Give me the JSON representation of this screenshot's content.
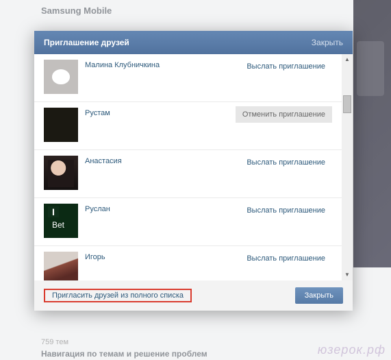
{
  "background": {
    "group_title": "Samsung Mobile",
    "topics_count": "759 тем",
    "nav_heading": "Навигация по темам и решение проблем",
    "watermark": "юзерок.рф"
  },
  "modal": {
    "title": "Приглашение друзей",
    "close_top": "Закрыть",
    "friends": [
      {
        "name": "Малина Клубничкина",
        "action": "Выслать приглашение",
        "cancelled": false,
        "avatar": "av-deer"
      },
      {
        "name": "Рустам",
        "action": "Отменить приглашение",
        "cancelled": true,
        "avatar": "av-dark1"
      },
      {
        "name": "Анастасия",
        "action": "Выслать приглашение",
        "cancelled": false,
        "avatar": "av-girl"
      },
      {
        "name": "Руслан",
        "action": "Выслать приглашение",
        "cancelled": false,
        "avatar": "av-ibet"
      },
      {
        "name": "Игорь",
        "action": "Выслать приглашение",
        "cancelled": false,
        "avatar": "av-guy"
      }
    ],
    "footer_link": "Пригласить друзей из полного списка",
    "close_button": "Закрыть"
  }
}
